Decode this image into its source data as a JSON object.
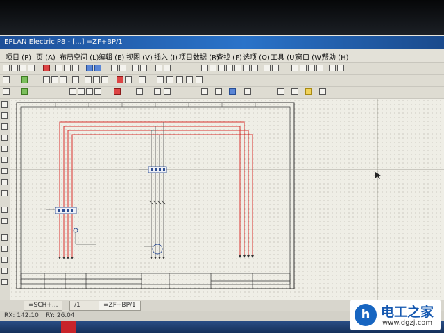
{
  "window": {
    "title": "EPLAN Electric P8 - [...] =ZF+BP/1"
  },
  "menu": [
    "项目 (P)",
    "页 (A)",
    "布局空间 (L)",
    "编辑 (E)",
    "视图 (V)",
    "插入 (I)",
    "项目数据 (R)",
    "查找 (F)",
    "选项 (O)",
    "工具 (U)",
    "窗口 (W)",
    "帮助 (H)"
  ],
  "tabs": [
    "=SCH+...",
    "/1",
    "=ZF+BP/1"
  ],
  "status": {
    "rx": "RX: 142.10",
    "ry": "RY: 26.04"
  },
  "watermark": {
    "name": "电工之家",
    "url": "www.dgzj.com",
    "logo": "h"
  },
  "colors": {
    "wire_red": "#d8322e",
    "wire_gray": "#5c5c5c",
    "border": "#333333",
    "titlebar": "#2a73c9"
  }
}
